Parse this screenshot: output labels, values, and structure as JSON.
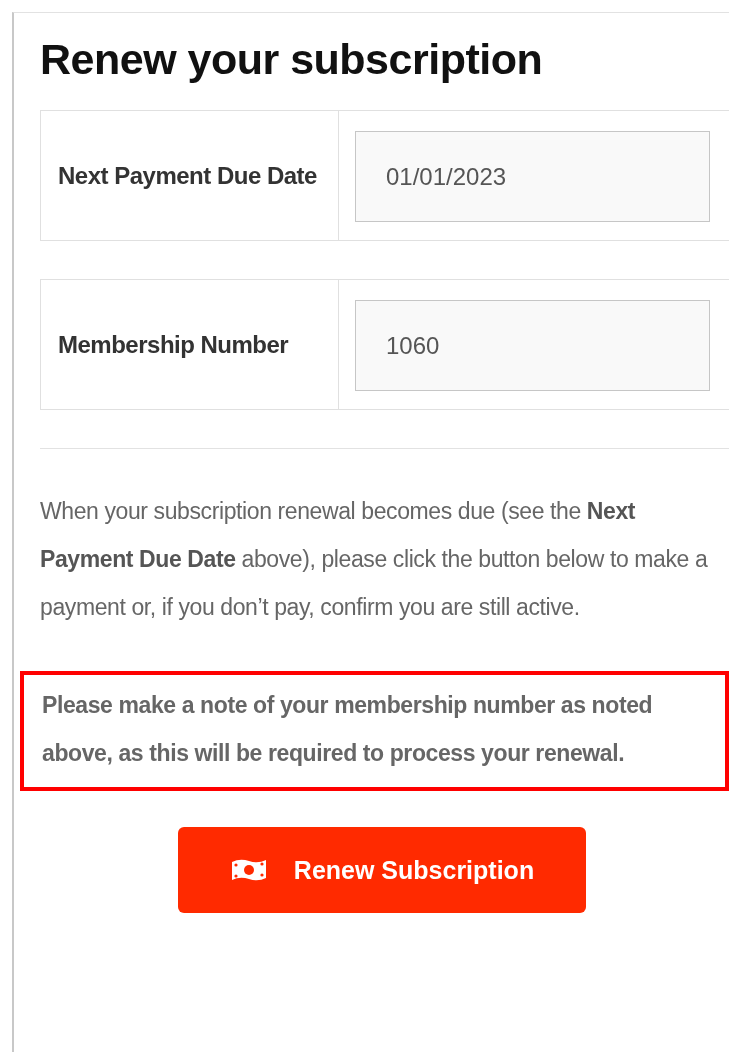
{
  "title": "Renew your subscription",
  "fields": [
    {
      "label": "Next Payment Due Date",
      "value": "01/01/2023"
    },
    {
      "label": "Membership Number",
      "value": "1060"
    }
  ],
  "instructions": "When your subscription renewal becomes due (see the **Next Payment Due Date** above), please click the button below to make a payment or, if you don’t pay, confirm you are still active.",
  "note": "Please make a note of your membership number as noted above, as this will be required to process your renewal.",
  "button": {
    "label": "Renew Subscription"
  }
}
